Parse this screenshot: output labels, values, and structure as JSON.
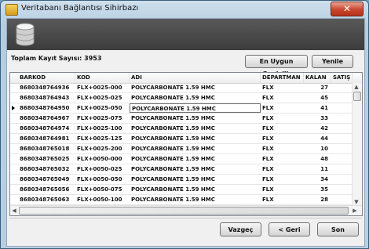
{
  "window": {
    "title": "Veritabanı Bağlantısı Sihirbazı",
    "close_symbol": "✕"
  },
  "summary": {
    "total_label": "Toplam Kayıt Sayısı: 3953"
  },
  "toolbar": {
    "best_width_label": "En Uygun Genişlik",
    "refresh_label": "Yenile"
  },
  "table": {
    "columns": [
      "BARKOD",
      "KOD",
      "ADI",
      "DEPARTMAN",
      "KALAN",
      "SATIŞ FİYAT"
    ],
    "rows": [
      [
        "8680348764936",
        "FLX+0025-000",
        "POLYCARBONATE 1.59 HMC",
        "FLX",
        "27",
        ""
      ],
      [
        "8680348764943",
        "FLX+0025-025",
        "POLYCARBONATE 1.59 HMC",
        "FLX",
        "45",
        ""
      ],
      [
        "8680348764950",
        "FLX+0025-050",
        "POLYCARBONATE 1.59 HMC",
        "FLX",
        "41",
        ""
      ],
      [
        "8680348764967",
        "FLX+0025-075",
        "POLYCARBONATE 1.59 HMC",
        "FLX",
        "33",
        ""
      ],
      [
        "8680348764974",
        "FLX+0025-100",
        "POLYCARBONATE 1.59 HMC",
        "FLX",
        "42",
        ""
      ],
      [
        "8680348764981",
        "FLX+0025-125",
        "POLYCARBONATE 1.59 HMC",
        "FLX",
        "44",
        ""
      ],
      [
        "8680348765018",
        "FLX+0025-200",
        "POLYCARBONATE 1.59 HMC",
        "FLX",
        "10",
        ""
      ],
      [
        "8680348765025",
        "FLX+0050-000",
        "POLYCARBONATE 1.59 HMC",
        "FLX",
        "48",
        ""
      ],
      [
        "8680348765032",
        "FLX+0050-025",
        "POLYCARBONATE 1.59 HMC",
        "FLX",
        "11",
        ""
      ],
      [
        "8680348765049",
        "FLX+0050-050",
        "POLYCARBONATE 1.59 HMC",
        "FLX",
        "34",
        ""
      ],
      [
        "8680348765056",
        "FLX+0050-075",
        "POLYCARBONATE 1.59 HMC",
        "FLX",
        "35",
        ""
      ],
      [
        "8680348765063",
        "FLX+0050-100",
        "POLYCARBONATE 1.59 HMC",
        "FLX",
        "28",
        ""
      ]
    ],
    "current_row_index": 2
  },
  "footer": {
    "cancel_label": "Vazgeç",
    "back_label": "< Geri",
    "finish_label": "Son"
  }
}
